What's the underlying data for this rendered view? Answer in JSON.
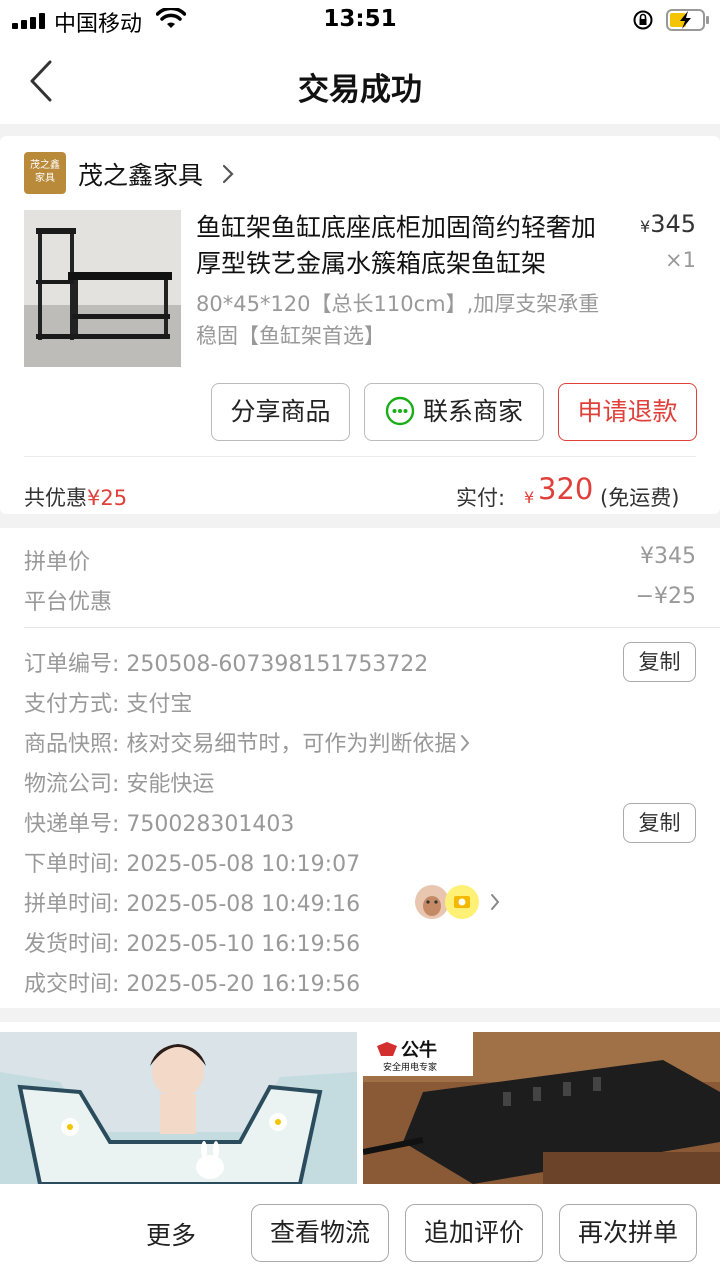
{
  "status_bar": {
    "carrier": "中国移动",
    "time": "13:51"
  },
  "nav": {
    "title": "交易成功"
  },
  "shop": {
    "logo_text_line1": "茂之鑫",
    "logo_text_line2": "家具",
    "name": "茂之鑫家具"
  },
  "product": {
    "title": "鱼缸架鱼缸底座底柜加固简约轻奢加厚型铁艺金属水簇箱底架鱼缸架",
    "spec": "80*45*120【总长110cm】,加厚支架承重稳固【鱼缸架首选】",
    "currency": "¥",
    "price": "345",
    "quantity": "×1"
  },
  "actions": {
    "share": "分享商品",
    "contact": "联系商家",
    "refund": "申请退款"
  },
  "summary": {
    "discount_label": "共优惠",
    "discount_amount": "¥25",
    "paid_label": "实付:",
    "paid_currency": "¥",
    "paid_amount": "320",
    "paid_note": "(免运费)"
  },
  "price_breakdown": [
    {
      "label": "拼单价",
      "value": "¥345"
    },
    {
      "label": "平台优惠",
      "value": "−¥25"
    }
  ],
  "order_info": {
    "order_no_label": "订单编号:",
    "order_no": "250508-607398151753722",
    "payment_label": "支付方式:",
    "payment": "支付宝",
    "snapshot_label": "商品快照:",
    "snapshot": "核对交易细节时，可作为判断依据",
    "logistics_label": "物流公司:",
    "logistics": "安能快运",
    "tracking_label": "快递单号:",
    "tracking": "750028301403",
    "order_time_label": "下单时间:",
    "order_time": "2025-05-08 10:19:07",
    "group_time_label": "拼单时间:",
    "group_time": "2025-05-08 10:49:16",
    "ship_time_label": "发货时间:",
    "ship_time": "2025-05-10 16:19:56",
    "deal_time_label": "成交时间:",
    "deal_time": "2025-05-20 16:19:56",
    "copy_label": "复制"
  },
  "banners": {
    "right_brand": "公牛",
    "right_tagline": "安全用电专家"
  },
  "bottom_bar": {
    "more": "更多",
    "logistics": "查看物流",
    "review": "追加评价",
    "reorder": "再次拼单"
  },
  "colors": {
    "accent_red": "#e0403a",
    "chat_green": "#1aad19"
  }
}
